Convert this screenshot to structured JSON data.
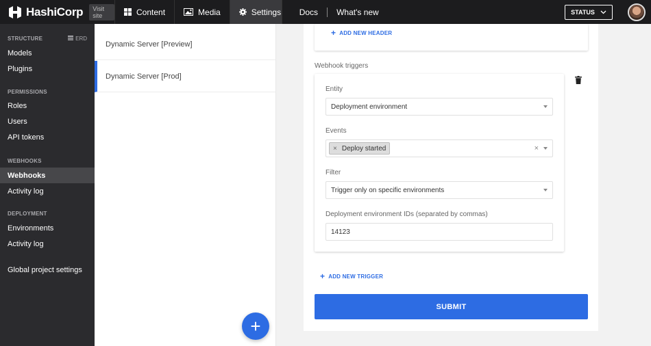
{
  "brand": {
    "name": "HashiCorp",
    "visit_label": "Visit site"
  },
  "topnav": {
    "items": [
      {
        "label": "Content",
        "icon": "grid-icon"
      },
      {
        "label": "Media",
        "icon": "image-icon"
      },
      {
        "label": "Settings",
        "icon": "gear-icon"
      }
    ],
    "links": [
      "Docs",
      "What's new"
    ],
    "status_label": "STATUS"
  },
  "sidebar": {
    "sections": {
      "structure": "STRUCTURE",
      "erd": "ERD",
      "permissions": "PERMISSIONS",
      "webhooks": "WEBHOOKS",
      "deployment": "DEPLOYMENT"
    },
    "items": {
      "models": "Models",
      "plugins": "Plugins",
      "roles": "Roles",
      "users": "Users",
      "api_tokens": "API tokens",
      "webhooks": "Webhooks",
      "webhooks_activity": "Activity log",
      "environments": "Environments",
      "deploy_activity": "Activity log",
      "global": "Global project settings"
    }
  },
  "webhook_list": [
    "Dynamic Server [Preview]",
    "Dynamic Server [Prod]"
  ],
  "form": {
    "add_header_label": "ADD NEW HEADER",
    "triggers_label": "Webhook triggers",
    "entity_label": "Entity",
    "entity_value": "Deployment environment",
    "events_label": "Events",
    "events_chip": "Deploy started",
    "filter_label": "Filter",
    "filter_value": "Trigger only on specific environments",
    "env_ids_label": "Deployment environment IDs (separated by commas)",
    "env_ids_value": "14123",
    "add_trigger_label": "ADD NEW TRIGGER",
    "submit_label": "SUBMIT"
  },
  "colors": {
    "accent": "#2d6ce3",
    "topbar": "#1c1c1e",
    "sidebar": "#2b2b2e"
  }
}
